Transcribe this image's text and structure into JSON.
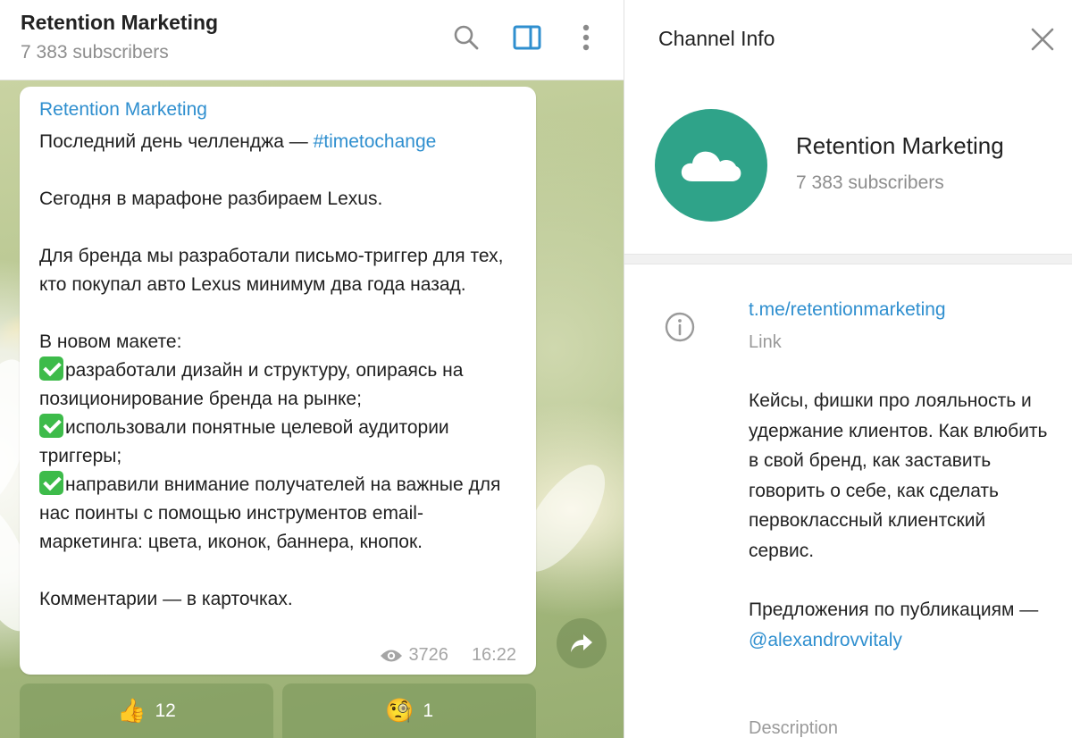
{
  "chat": {
    "title": "Retention Marketing",
    "subtitle": "7 383 subscribers",
    "icons": [
      "search-icon",
      "sidebar-toggle-icon",
      "more-vertical-icon"
    ]
  },
  "message": {
    "author": "Retention Marketing",
    "line1_text": "Последний день челленджа — ",
    "line1_hashtag": "#timetochange",
    "p2": "Сегодня в марафоне разбираем Lexus.",
    "p3": "Для бренда мы разработали письмо-триггер для тех, кто покупал авто Lexus минимум два года назад.",
    "p4_title": "В новом макете:",
    "bullet1": "разработали дизайн и структуру, опираясь на позиционирование бренда на рынке;",
    "bullet2": "использовали понятные целевой аудитории триггеры;",
    "bullet3": "направили внимание получателей на важные для нас поинты с помощью инструментов email-маркетинга: цвета, иконок, баннера, кнопок.",
    "p5": "Комментарии — в карточках.",
    "views": "3726",
    "time": "16:22"
  },
  "reactions": [
    {
      "emoji": "👍",
      "icon": "thumbs-up-icon",
      "count": "12"
    },
    {
      "emoji": "🧐",
      "icon": "monocle-face-icon",
      "count": "1"
    }
  ],
  "info": {
    "title": "Channel Info",
    "channel_name": "Retention Marketing",
    "channel_sub": "7 383 subscribers",
    "link": "t.me/retentionmarketing",
    "link_label": "Link",
    "description": "Кейсы, фишки про лояльность и удержание клиентов. Как влюбить в свой бренд, как заставить говорить о себе, как сделать первоклассный клиентский сервис.",
    "offer_text": "Предложения по публикациям — ",
    "mention": "@alexandrovvitaly",
    "description_label": "Description",
    "avatar_color": "#2fa389",
    "accent_color": "#2f8fcf"
  }
}
